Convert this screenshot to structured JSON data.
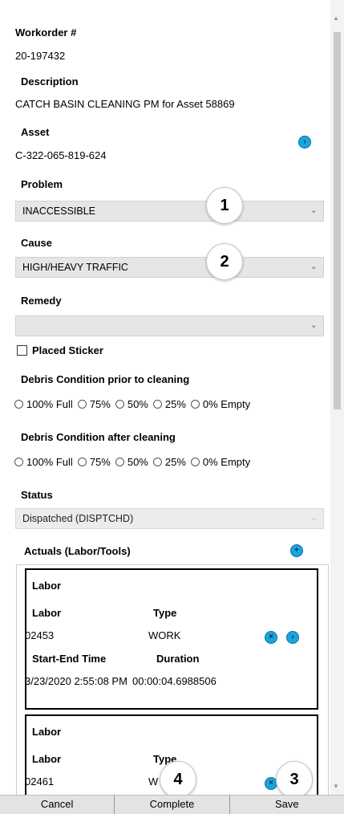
{
  "form": {
    "workorder_label": "Workorder #",
    "workorder_value": "20-197432",
    "description_label": "Description",
    "description_value": "CATCH BASIN CLEANING PM for Asset 58869",
    "asset_label": "Asset",
    "asset_value": "C-322-065-819-624",
    "problem_label": "Problem",
    "problem_value": "INACCESSIBLE",
    "cause_label": "Cause",
    "cause_value": "HIGH/HEAVY TRAFFIC",
    "remedy_label": "Remedy",
    "remedy_value": "",
    "placed_sticker_label": "Placed Sticker",
    "placed_sticker_checked": false,
    "debris_prior_label": "Debris Condition prior to cleaning",
    "debris_after_label": "Debris Condition after cleaning",
    "debris_options": [
      "100% Full",
      "75%",
      "50%",
      "25%",
      "0% Empty"
    ],
    "status_label": "Status",
    "status_value": "Dispatched (DISPTCHD)",
    "actuals_label": "Actuals (Labor/Tools)"
  },
  "labor_cards": [
    {
      "title": "Labor",
      "labor_label": "Labor",
      "type_label": "Type",
      "labor_value": "02453",
      "type_value": "WORK",
      "time_label": "Start-End Time",
      "duration_label": "Duration",
      "time_value": "3/23/2020 2:55:08 PM",
      "duration_value": "00:00:04.6988506"
    },
    {
      "title": "Labor",
      "labor_label": "Labor",
      "type_label": "Type",
      "labor_value": "02461",
      "type_value": "W"
    }
  ],
  "callouts": [
    "1",
    "2",
    "3",
    "4"
  ],
  "footer": {
    "cancel_label": "Cancel",
    "complete_label": "Complete",
    "save_label": "Save"
  },
  "colors": {
    "accent": "#1aa5e0",
    "field_bg": "#e6e6e6",
    "button_bg": "#e3e3e3"
  },
  "icons": {
    "asset_nav": "chevron-right-circle-icon",
    "add_actual": "plus-circle-icon",
    "delete_labor": "close-circle-icon",
    "open_labor": "chevron-right-circle-icon",
    "dropdown": "chevron-down-icon"
  }
}
